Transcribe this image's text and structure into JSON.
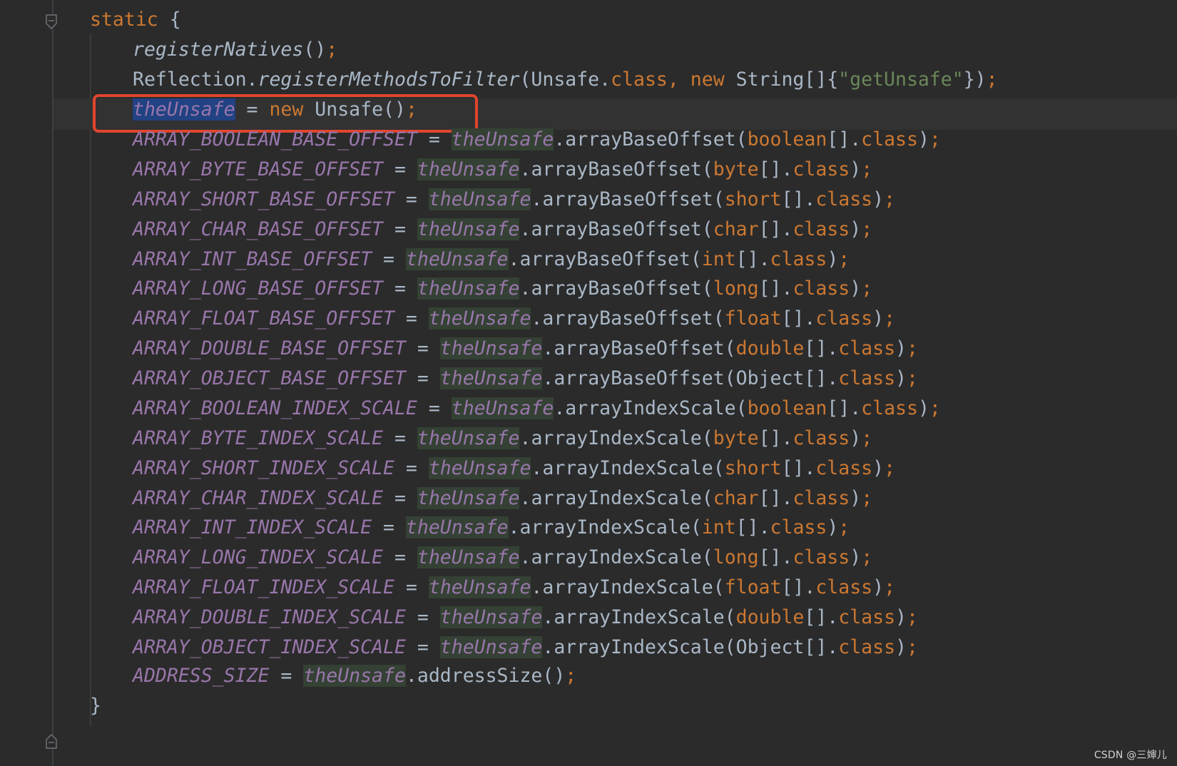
{
  "colors": {
    "background": "#2b2b2b",
    "keyword": "#cc7832",
    "string": "#6a8759",
    "static_field": "#9876aa",
    "default_text": "#a9b7c6",
    "usage_highlight": "#344134",
    "selection": "#214283",
    "callout_box": "#e0452d"
  },
  "code": {
    "static_keyword": "static",
    "open_brace": " {",
    "close_brace": "}",
    "line_register_natives": {
      "method": "registerNatives",
      "rest": "()",
      "semi": ";"
    },
    "line_reflection": {
      "cls": "Reflection.",
      "method": "registerMethodsToFilter",
      "arg1": "(Unsafe.",
      "class_kw": "class",
      "comma": ", ",
      "new_kw": "new",
      "arg2": " String[]{",
      "str": "\"getUnsafe\"",
      "close": "})",
      "semi": ";"
    },
    "line_the_unsafe": {
      "field": "theUnsafe",
      "eq": " = ",
      "new_kw": "new",
      "rest": " Unsafe()",
      "semi": ";"
    },
    "assignments": [
      {
        "field": "ARRAY_BOOLEAN_BASE_OFFSET",
        "method": "arrayBaseOffset",
        "type": "boolean"
      },
      {
        "field": "ARRAY_BYTE_BASE_OFFSET",
        "method": "arrayBaseOffset",
        "type": "byte"
      },
      {
        "field": "ARRAY_SHORT_BASE_OFFSET",
        "method": "arrayBaseOffset",
        "type": "short"
      },
      {
        "field": "ARRAY_CHAR_BASE_OFFSET",
        "method": "arrayBaseOffset",
        "type": "char"
      },
      {
        "field": "ARRAY_INT_BASE_OFFSET",
        "method": "arrayBaseOffset",
        "type": "int"
      },
      {
        "field": "ARRAY_LONG_BASE_OFFSET",
        "method": "arrayBaseOffset",
        "type": "long"
      },
      {
        "field": "ARRAY_FLOAT_BASE_OFFSET",
        "method": "arrayBaseOffset",
        "type": "float"
      },
      {
        "field": "ARRAY_DOUBLE_BASE_OFFSET",
        "method": "arrayBaseOffset",
        "type": "double"
      },
      {
        "field": "ARRAY_OBJECT_BASE_OFFSET",
        "method": "arrayBaseOffset",
        "type": "Object",
        "type_is_keyword": false
      },
      {
        "field": "ARRAY_BOOLEAN_INDEX_SCALE",
        "method": "arrayIndexScale",
        "type": "boolean"
      },
      {
        "field": "ARRAY_BYTE_INDEX_SCALE",
        "method": "arrayIndexScale",
        "type": "byte"
      },
      {
        "field": "ARRAY_SHORT_INDEX_SCALE",
        "method": "arrayIndexScale",
        "type": "short"
      },
      {
        "field": "ARRAY_CHAR_INDEX_SCALE",
        "method": "arrayIndexScale",
        "type": "char"
      },
      {
        "field": "ARRAY_INT_INDEX_SCALE",
        "method": "arrayIndexScale",
        "type": "int"
      },
      {
        "field": "ARRAY_LONG_INDEX_SCALE",
        "method": "arrayIndexScale",
        "type": "long"
      },
      {
        "field": "ARRAY_FLOAT_INDEX_SCALE",
        "method": "arrayIndexScale",
        "type": "float"
      },
      {
        "field": "ARRAY_DOUBLE_INDEX_SCALE",
        "method": "arrayIndexScale",
        "type": "double"
      },
      {
        "field": "ARRAY_OBJECT_INDEX_SCALE",
        "method": "arrayIndexScale",
        "type": "Object",
        "type_is_keyword": false
      }
    ],
    "assign_eq": " = ",
    "receiver": "theUnsafe",
    "dot": ".",
    "open_paren": "(",
    "array_suffix": "[].",
    "class_kw": "class",
    "close_paren": ")",
    "semi": ";",
    "line_address_size": {
      "field": "ADDRESS_SIZE",
      "eq": " = ",
      "receiver": "theUnsafe",
      "call": ".addressSize()",
      "semi": ";"
    }
  },
  "watermark": "CSDN @三婶儿"
}
